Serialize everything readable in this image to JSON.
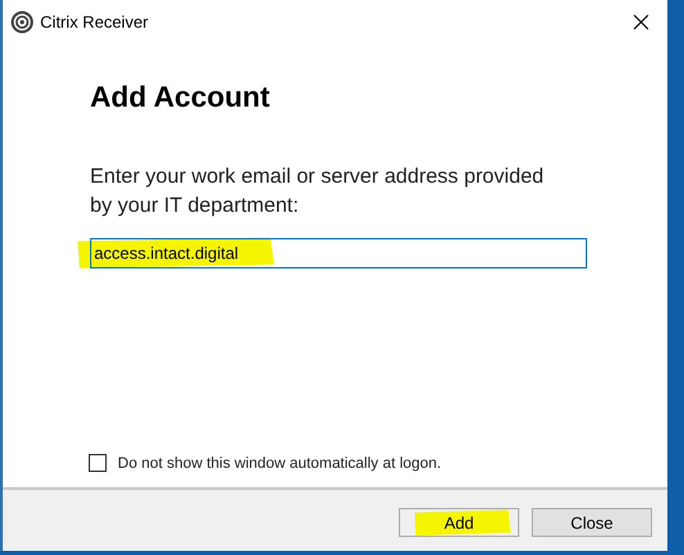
{
  "window": {
    "title": "Citrix Receiver"
  },
  "heading": "Add Account",
  "prompt": "Enter your work email or server address provided by your IT department:",
  "address_field": {
    "value": "access.intact.digital",
    "highlighted": true
  },
  "checkbox": {
    "label": "Do not show this window automatically at logon.",
    "checked": false
  },
  "buttons": [
    {
      "label": "Add",
      "highlighted": true
    },
    {
      "label": "Close",
      "highlighted": false
    }
  ]
}
